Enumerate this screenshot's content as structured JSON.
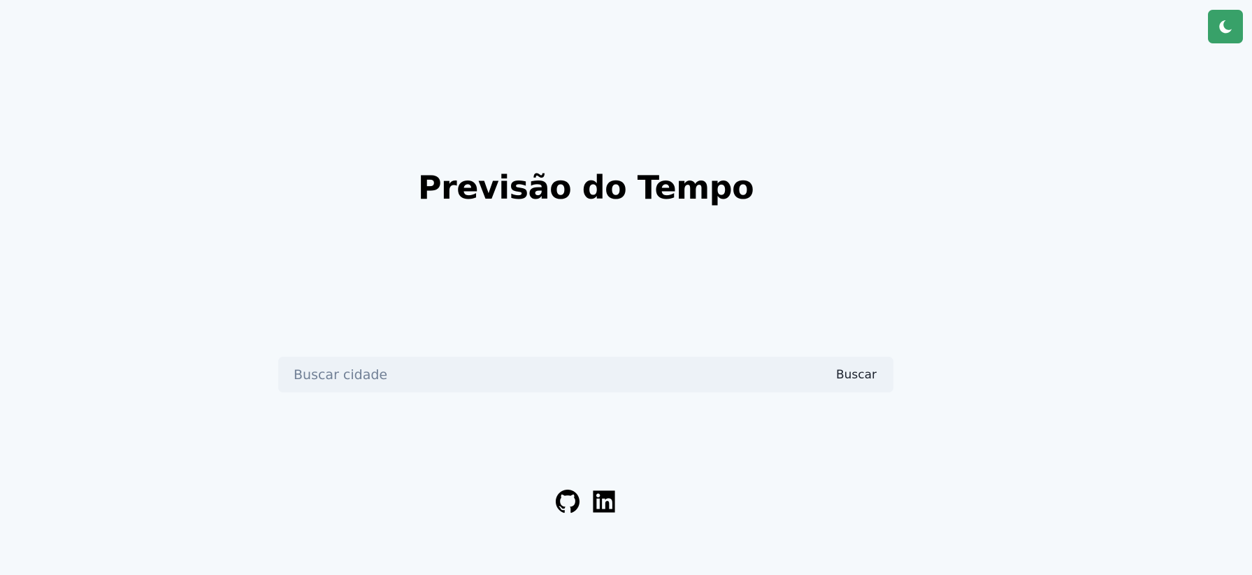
{
  "header": {
    "theme_toggle_icon": "moon-icon",
    "theme_toggle_color": "#38a169"
  },
  "main": {
    "title": "Previsão do Tempo"
  },
  "search": {
    "placeholder": "Buscar cidade",
    "value": "",
    "button_label": "Buscar"
  },
  "footer": {
    "links": [
      {
        "icon": "github-icon"
      },
      {
        "icon": "linkedin-icon"
      }
    ]
  },
  "colors": {
    "background": "#f5f9fc",
    "search_background": "#edf2f7",
    "accent": "#38a169"
  }
}
